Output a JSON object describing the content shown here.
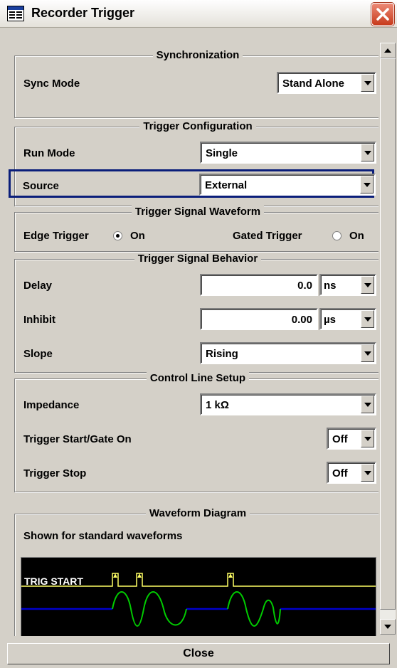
{
  "window": {
    "title": "Recorder Trigger",
    "icon": "app-window-icon",
    "close_icon": "close-x-icon"
  },
  "sync": {
    "title": "Synchronization",
    "mode_label": "Sync Mode",
    "mode_value": "Stand Alone"
  },
  "trigger_config": {
    "title": "Trigger Configuration",
    "run_mode_label": "Run Mode",
    "run_mode_value": "Single",
    "source_label": "Source",
    "source_value": "External"
  },
  "waveform": {
    "title": "Trigger Signal Waveform",
    "edge_label": "Edge Trigger",
    "edge_option": "On",
    "edge_selected": true,
    "gated_label": "Gated Trigger",
    "gated_option": "On",
    "gated_selected": false
  },
  "behavior": {
    "title": "Trigger Signal Behavior",
    "delay_label": "Delay",
    "delay_value": "0.0",
    "delay_unit": "ns",
    "inhibit_label": "Inhibit",
    "inhibit_value": "0.00",
    "inhibit_unit": "µs",
    "slope_label": "Slope",
    "slope_value": "Rising"
  },
  "control_line": {
    "title": "Control Line Setup",
    "impedance_label": "Impedance",
    "impedance_value": "1 kΩ",
    "start_label": "Trigger Start/Gate On",
    "start_value": "Off",
    "stop_label": "Trigger Stop",
    "stop_value": "Off"
  },
  "diagram": {
    "title": "Waveform Diagram",
    "subtitle": "Shown for standard waveforms",
    "signal_label": "TRIG START",
    "colors": {
      "trigger": "#ffff66",
      "baseline": "#0000cc",
      "wave": "#00cc00",
      "background": "#000000"
    }
  },
  "footer": {
    "close_label": "Close"
  }
}
